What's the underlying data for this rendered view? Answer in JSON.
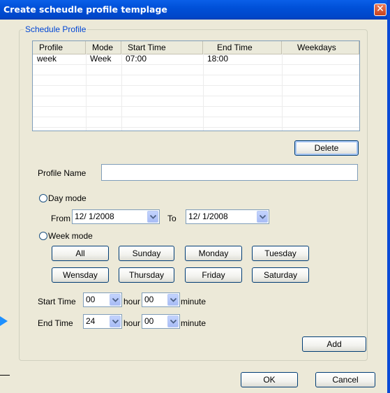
{
  "window": {
    "title": "Create scheudle profile templage",
    "close_icon": "close-icon"
  },
  "schedule_profile": {
    "group_label": "Schedule Profile",
    "columns": [
      "Profile",
      "Mode",
      "Start Time",
      "End Time",
      "Weekdays"
    ],
    "rows": [
      [
        "week",
        "Week",
        "07:00",
        "18:00",
        ""
      ]
    ]
  },
  "buttons": {
    "delete": "Delete",
    "add": "Add",
    "ok": "OK",
    "cancel": "Cancel"
  },
  "profile_name": {
    "label": "Profile Name",
    "value": ""
  },
  "day_mode": {
    "label": "Day mode",
    "from_label": "From",
    "from_value": "12/ 1/2008",
    "to_label": "To",
    "to_value": "12/ 1/2008"
  },
  "week_mode": {
    "label": "Week mode",
    "days": [
      "All",
      "Sunday",
      "Monday",
      "Tuesday",
      "Wensday",
      "Thursday",
      "Friday",
      "Saturday"
    ]
  },
  "start_time": {
    "label": "Start Time",
    "hour": "00",
    "hour_label": "hour",
    "minute": "00",
    "minute_label": "minute"
  },
  "end_time": {
    "label": "End Time",
    "hour": "24",
    "hour_label": "hour",
    "minute": "00",
    "minute_label": "minute"
  },
  "colors": {
    "title_bar": "#0050d8",
    "dialog_bg": "#ece9d8",
    "group_label": "#0046d5",
    "arrow_marker": "#1e90ff"
  }
}
